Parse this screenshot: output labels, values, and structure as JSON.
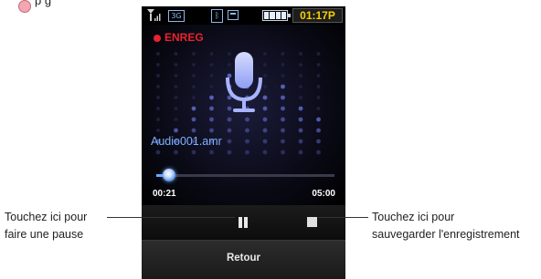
{
  "top_fragment": "p                                            g",
  "status_bar": {
    "network_badge": "3G",
    "bluetooth_icon": "bluetooth-icon",
    "time": "01:17P"
  },
  "recorder": {
    "rec_label": "ENREG",
    "filename": "Audio001.amr",
    "progress_fraction": 0.07,
    "elapsed": "00:21",
    "total": "05:00"
  },
  "controls": {
    "pause_icon": "pause-icon",
    "stop_icon": "stop-icon"
  },
  "bottom_bar": {
    "back_label": "Retour"
  },
  "callouts": {
    "pause": [
      "Touchez ici pour",
      "faire une pause"
    ],
    "save": [
      "Touchez ici pour",
      "sauvegarder l'enregistrement"
    ]
  },
  "colors": {
    "accent": "#7fb2ff",
    "record": "#e8232d",
    "clock": "#f5d000",
    "mic": "#b8c4ff"
  }
}
